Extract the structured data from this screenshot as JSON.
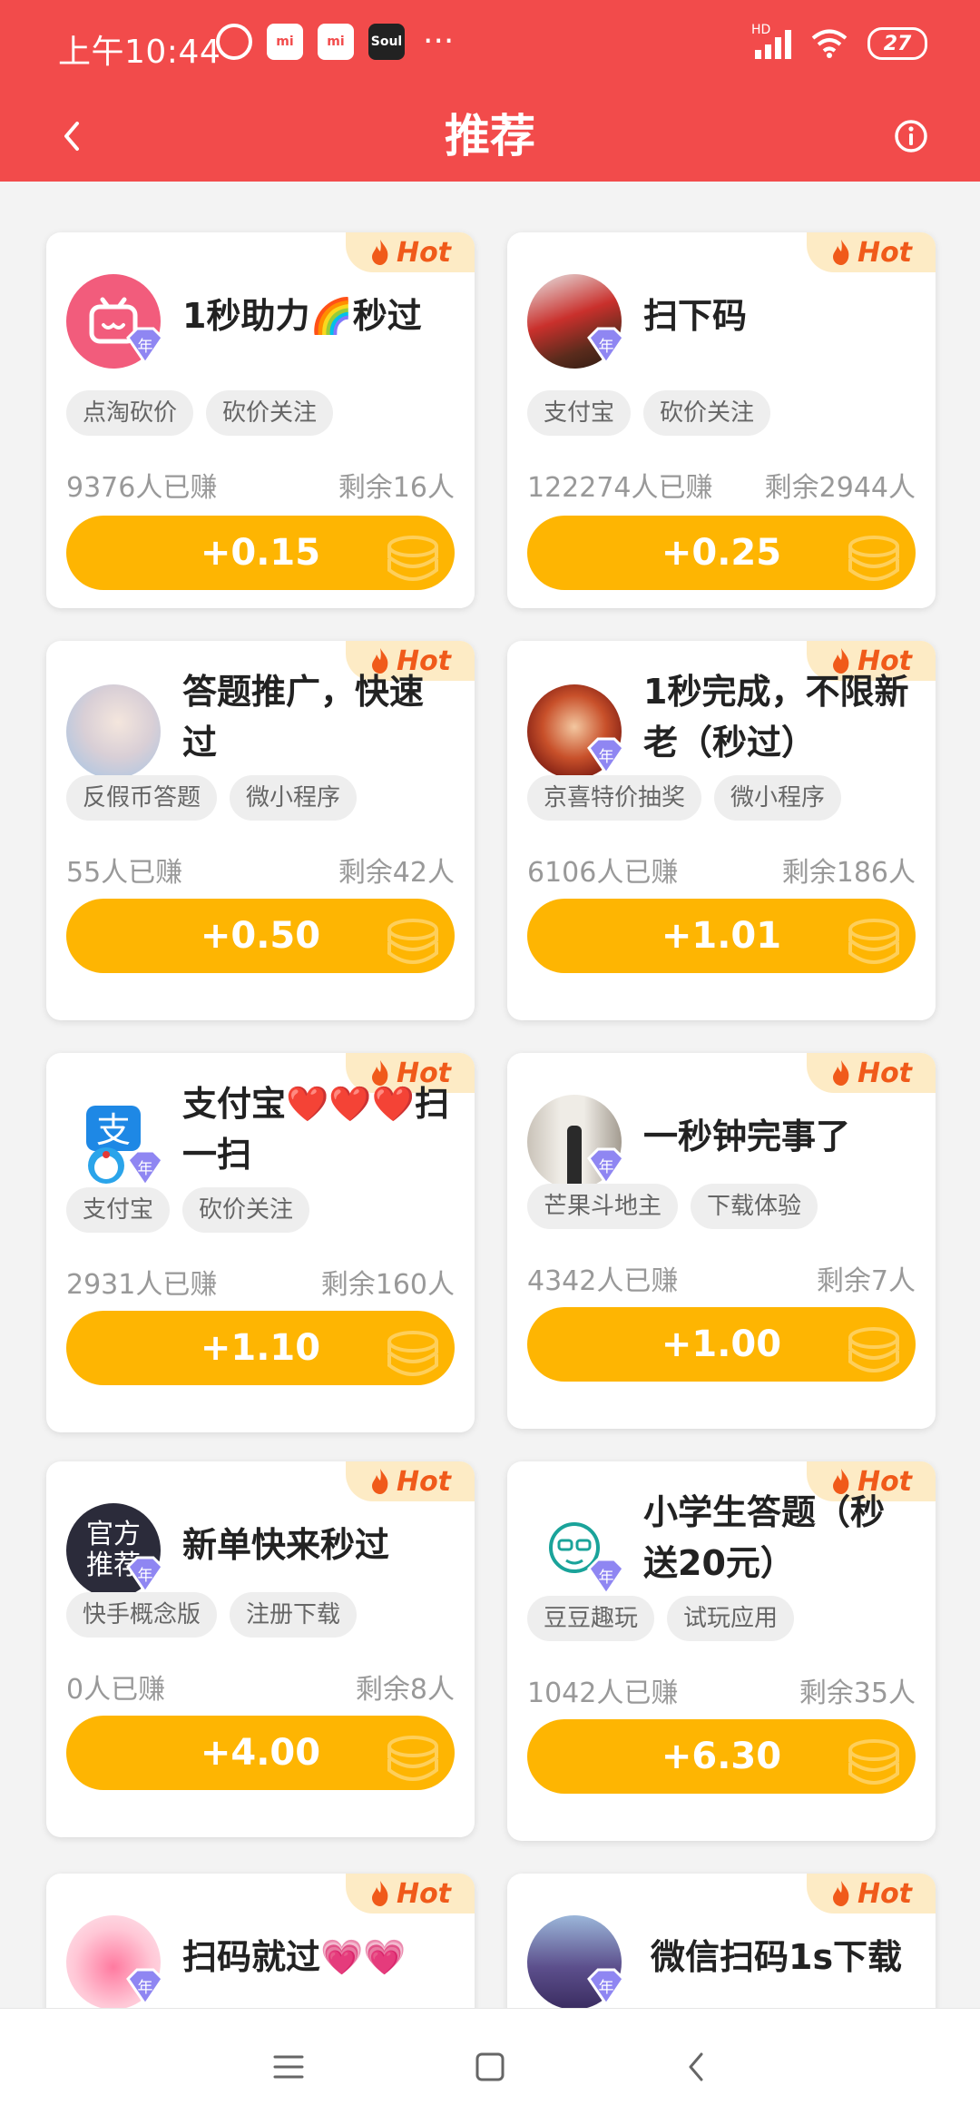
{
  "status_bar": {
    "time": "上午10:44",
    "icons": [
      "alarm-icon",
      "mi-icon",
      "mi-icon",
      "soul-icon",
      "more-dots"
    ],
    "soul_label": "Soul",
    "mi_label": "mi",
    "more": "···",
    "hd_label": "HD",
    "battery": "27"
  },
  "app_bar": {
    "title": "推荐",
    "back_icon": "chevron-left-icon",
    "info_icon": "info-icon"
  },
  "hot_label": "Hot",
  "year_label": "年",
  "colors": {
    "accent": "#f24b4b",
    "button": "#feb502",
    "hot_bg": "#fdebc5",
    "hot_text": "#f05a1a"
  },
  "cards": [
    {
      "title": "1秒助力🌈秒过",
      "tags": [
        "点淘砍价",
        "砍价关注"
      ],
      "earned": "9376人已赚",
      "remaining": "剩余16人",
      "reward": "+0.15"
    },
    {
      "title": "扫下码",
      "tags": [
        "支付宝",
        "砍价关注"
      ],
      "earned": "122274人已赚",
      "remaining": "剩余2944人",
      "reward": "+0.25"
    },
    {
      "title": "答题推广，快速过",
      "tags": [
        "反假币答题",
        "微小程序"
      ],
      "earned": "55人已赚",
      "remaining": "剩余42人",
      "reward": "+0.50"
    },
    {
      "title": "1秒完成，不限新老（秒过）",
      "tags": [
        "京喜特价抽奖",
        "微小程序"
      ],
      "earned": "6106人已赚",
      "remaining": "剩余186人",
      "reward": "+1.01"
    },
    {
      "title": "支付宝❤️❤️❤️扫一扫",
      "tags": [
        "支付宝",
        "砍价关注"
      ],
      "earned": "2931人已赚",
      "remaining": "剩余160人",
      "reward": "+1.10"
    },
    {
      "title": "一秒钟完事了",
      "tags": [
        "芒果斗地主",
        "下载体验"
      ],
      "earned": "4342人已赚",
      "remaining": "剩余7人",
      "reward": "+1.00"
    },
    {
      "title": "新单快来秒过",
      "tags": [
        "快手概念版",
        "注册下载"
      ],
      "earned": "0人已赚",
      "remaining": "剩余8人",
      "reward": "+4.00",
      "avatar_text": [
        "官方",
        "推荐"
      ]
    },
    {
      "title": "小学生答题（秒送20元）",
      "tags": [
        "豆豆趣玩",
        "试玩应用"
      ],
      "earned": "1042人已赚",
      "remaining": "剩余35人",
      "reward": "+6.30"
    },
    {
      "title": "扫码就过💗💗",
      "tags": [],
      "earned": "",
      "remaining": "",
      "reward": ""
    },
    {
      "title": "微信扫码1s下载",
      "tags": [],
      "earned": "",
      "remaining": "",
      "reward": ""
    }
  ],
  "nav_bar": {
    "buttons": [
      "menu-icon",
      "home-square-icon",
      "back-icon"
    ]
  }
}
